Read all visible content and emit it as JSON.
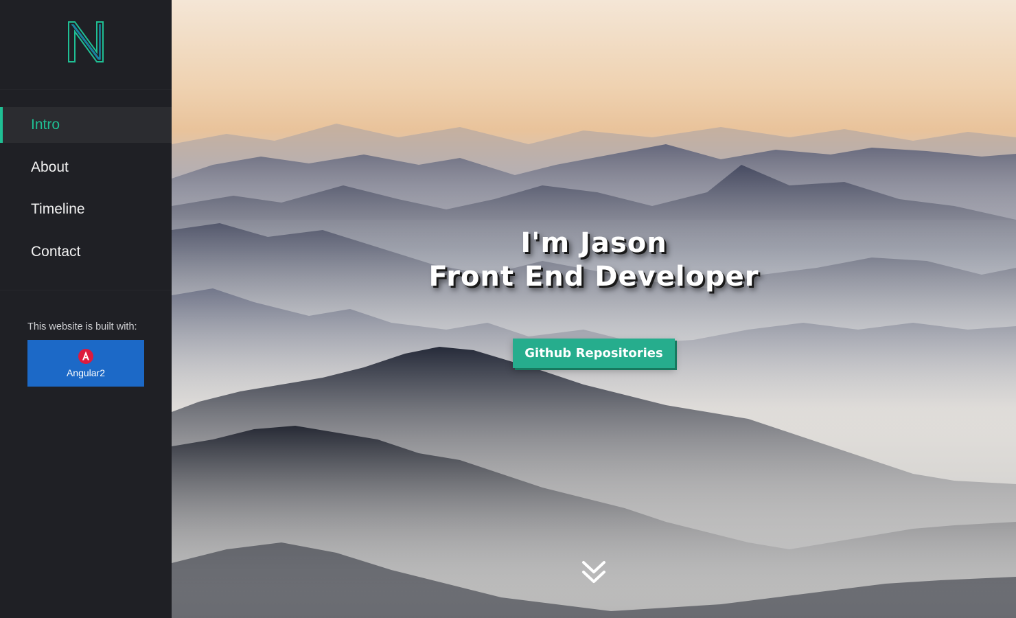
{
  "sidebar": {
    "logo_icon": "n-logo-icon",
    "nav_items": [
      {
        "label": "Intro",
        "active": true
      },
      {
        "label": "About",
        "active": false
      },
      {
        "label": "Timeline",
        "active": false
      },
      {
        "label": "Contact",
        "active": false
      }
    ],
    "built_with_label": "This website is built with:",
    "built_with_badge": {
      "label": "Angular2",
      "icon": "angular-icon"
    }
  },
  "hero": {
    "title_line1": "I'm Jason",
    "title_line2": "Front End Developer",
    "cta_label": "Github Repositories",
    "scroll_icon": "double-chevron-down-icon"
  },
  "colors": {
    "accent": "#1fbf94",
    "sidebar_bg": "#1f2025",
    "button_bg": "#26ad8d",
    "badge_bg": "#1c69c7"
  }
}
